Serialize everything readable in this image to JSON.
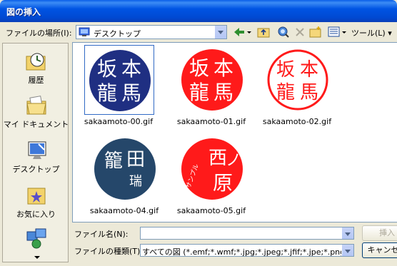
{
  "window": {
    "title": "図の挿入"
  },
  "lookin": {
    "label": "ファイルの場所(I):",
    "value": "デスクトップ"
  },
  "toolbar": {
    "tools_label": "ツール(L)"
  },
  "places": [
    {
      "label": "履歴",
      "icon": "history-icon"
    },
    {
      "label": "マイ ドキュメント",
      "icon": "my-documents-icon"
    },
    {
      "label": "デスクトップ",
      "icon": "desktop-icon"
    },
    {
      "label": "お気に入り",
      "icon": "favorites-icon"
    },
    {
      "label": "",
      "icon": "network-icon"
    }
  ],
  "files": [
    {
      "name": "sakaamoto-00.gif",
      "stamp_text": [
        "坂",
        "本",
        "龍",
        "馬"
      ],
      "style": "blue-white"
    },
    {
      "name": "sakaamoto-01.gif",
      "stamp_text": [
        "坂",
        "本",
        "龍",
        "馬"
      ],
      "style": "red-white"
    },
    {
      "name": "sakaamoto-02.gif",
      "stamp_text": [
        "坂",
        "本",
        "龍",
        "馬"
      ],
      "style": "white-red"
    },
    {
      "name": "sakaamoto-04.gif",
      "stamp_text": [
        "籠",
        "田",
        "瑞"
      ],
      "style": "navy-white"
    },
    {
      "name": "sakaamoto-05.gif",
      "stamp_text": [
        "西",
        "ノ",
        "原",
        "サンプル"
      ],
      "style": "red-white"
    }
  ],
  "filename": {
    "label": "ファイル名(N):",
    "value": ""
  },
  "filetype": {
    "label": "ファイルの種類(T):",
    "value": "すべての図 (*.emf;*.wmf;*.jpg;*.jpeg;*.jfif;*.jpe;*.png;*.bmp"
  },
  "buttons": {
    "insert": "挿入",
    "cancel": "キャンセル"
  },
  "colors": {
    "navy": "#1f2f82",
    "red": "#ff1a1a",
    "darkblue": "#25476a",
    "accent": "#316ac5"
  }
}
